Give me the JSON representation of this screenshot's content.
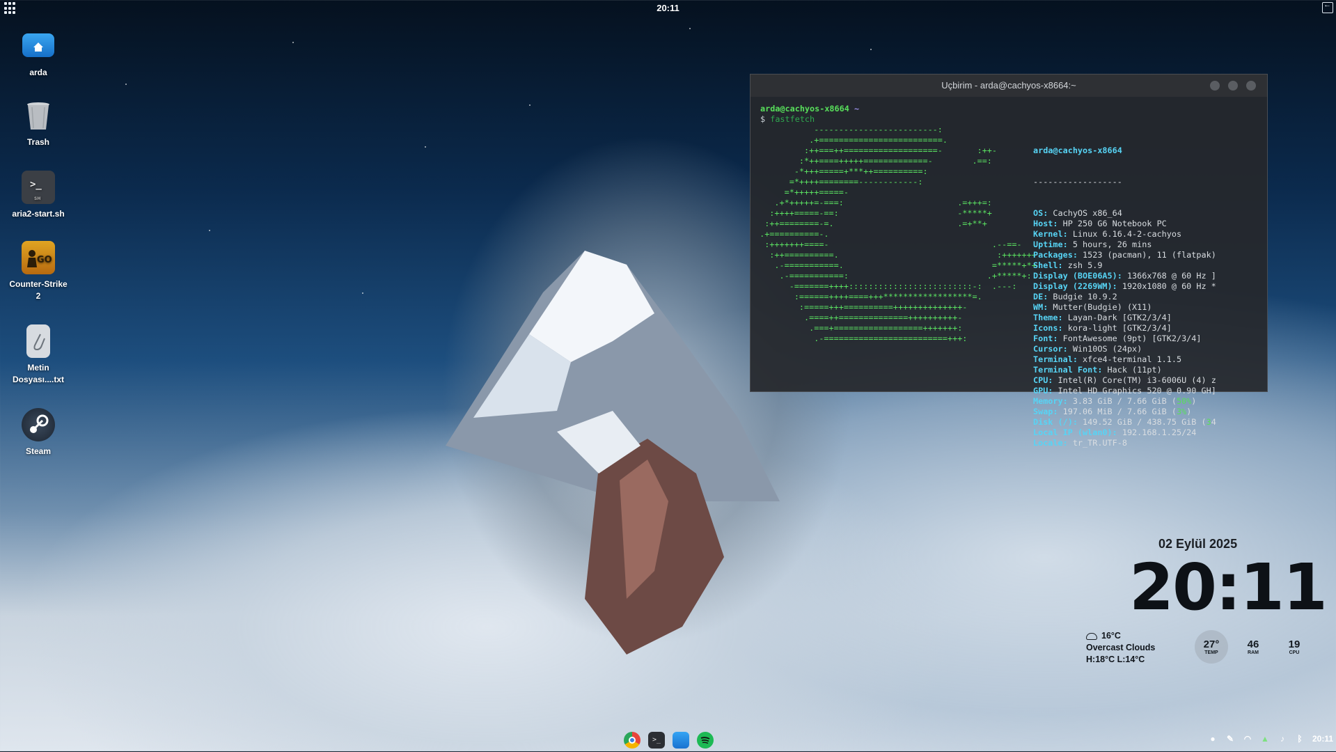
{
  "topbar": {
    "clock": "20:11"
  },
  "desktop": {
    "icons": [
      {
        "label": "arda",
        "icon": "home-folder-icon"
      },
      {
        "label": "Trash",
        "icon": "trash-icon"
      },
      {
        "label": "aria2-start.sh",
        "icon": "terminal-script-icon"
      },
      {
        "label": "Counter-Strike 2",
        "icon": "csgo-icon"
      },
      {
        "label": "Metin Dosyası....txt",
        "icon": "text-file-icon"
      },
      {
        "label": "Steam",
        "icon": "steam-icon"
      }
    ]
  },
  "terminal": {
    "title": "Uçbirim - arda@cachyos-x8664:~",
    "prompt_user": "arda@cachyos-x8664",
    "prompt_path": "~",
    "command_symbol": "$",
    "command": "fastfetch",
    "ascii": [
      "            -------------------------:",
      "           .+=========================.",
      "          :++===++===================-       :++-",
      "         :*++====+++++=============-        .==:",
      "        -*+++=====+***++==========:",
      "       =*++++========------------:",
      "      =*+++++=====-",
      "    .+*+++++=-===:                       .=+++=:",
      "   :++++=====-==:                        -*****+",
      "  :++========-=.                         .=+**+",
      " .+==========-.",
      "  :+++++++====-                                 .--==-",
      "   :++==========.                                :+++++++",
      "    .-===========.                              =*****+*+",
      "     .-===========:                            .+*****+:",
      "       -=======++++:::::::::::::::::::::::::-:  .---:",
      "        :======++++====+++******************=.",
      "         :=====+++==========++++++++++++++-",
      "          .====++==============++++++++++-",
      "           .===+==================+++++++:",
      "            .-=========================+++:"
    ],
    "info_header": "arda@cachyos-x8664",
    "separator": "------------------",
    "info": [
      {
        "key": "OS",
        "value": "CachyOS x86_64"
      },
      {
        "key": "Host",
        "value": "HP 250 G6 Notebook PC"
      },
      {
        "key": "Kernel",
        "value": "Linux 6.16.4-2-cachyos"
      },
      {
        "key": "Uptime",
        "value": "5 hours, 26 mins"
      },
      {
        "key": "Packages",
        "value": "1523 (pacman), 11 (flatpak)"
      },
      {
        "key": "Shell",
        "value": "zsh 5.9"
      },
      {
        "key": "Display (BOE06A5)",
        "value": "1366x768 @ 60 Hz ]"
      },
      {
        "key": "Display (2269WM)",
        "value": "1920x1080 @ 60 Hz *"
      },
      {
        "key": "DE",
        "value": "Budgie 10.9.2"
      },
      {
        "key": "WM",
        "value": "Mutter(Budgie) (X11)"
      },
      {
        "key": "Theme",
        "value": "Layan-Dark [GTK2/3/4]"
      },
      {
        "key": "Icons",
        "value": "kora-light [GTK2/3/4]"
      },
      {
        "key": "Font",
        "value": "FontAwesome (9pt) [GTK2/3/4]"
      },
      {
        "key": "Cursor",
        "value": "Win10OS (24px)"
      },
      {
        "key": "Terminal",
        "value": "xfce4-terminal 1.1.5"
      },
      {
        "key": "Terminal Font",
        "value": "Hack (11pt)"
      },
      {
        "key": "CPU",
        "value": "Intel(R) Core(TM) i3-6006U (4) z"
      },
      {
        "key": "GPU",
        "value": "Intel HD Graphics 520 @ 0.90 GH]"
      },
      {
        "key": "Memory",
        "value": "3.83 GiB / 7.66 GiB (",
        "pct": "50%",
        "tail": ")"
      },
      {
        "key": "Swap",
        "value": "197.06 MiB / 7.66 GiB (",
        "pct": "3%",
        "tail": ")"
      },
      {
        "key": "Disk (/)",
        "value": "149.52 GiB / 438.75 GiB (",
        "pct": "3",
        "tail": "4"
      },
      {
        "key": "Local IP (wlan0)",
        "value": "192.168.1.25/24"
      },
      {
        "key": "Locale",
        "value": "tr_TR.UTF-8"
      }
    ]
  },
  "widget": {
    "date": "02 Eylül 2025",
    "time": "20:11",
    "weather_temp": "16°C",
    "weather_desc": "Overcast Clouds",
    "weather_hilo": "H:18°C  L:14°C",
    "gauges": [
      {
        "value": "27°",
        "label": "TEMP"
      },
      {
        "value": "46",
        "label": "RAM"
      },
      {
        "value": "19",
        "label": "CPU"
      }
    ]
  },
  "dock": {
    "items": [
      "chrome-icon",
      "terminal-icon",
      "files-icon",
      "spotify-icon"
    ]
  },
  "tray": {
    "clock": "20:11"
  },
  "colors": {
    "terminal_green": "#58e05b",
    "terminal_cyan": "#57d4f5"
  }
}
